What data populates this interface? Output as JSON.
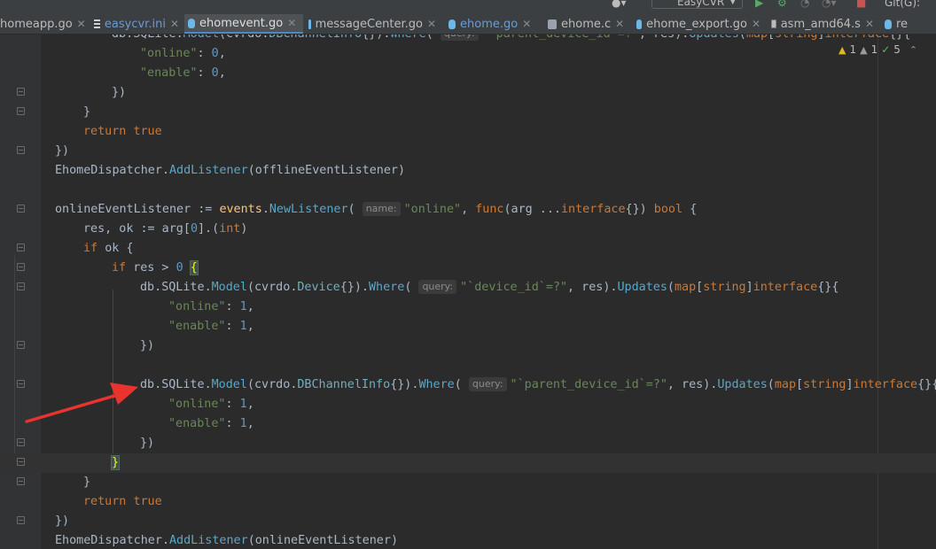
{
  "tabs": [
    {
      "label": "homeapp.go",
      "icon": "go-file-icon",
      "active": false
    },
    {
      "label": "easycvr.ini",
      "icon": "ini-file-icon",
      "active": false
    },
    {
      "label": "ehomevent.go",
      "icon": "go-file-icon",
      "active": true
    },
    {
      "label": "messageCenter.go",
      "icon": "go-file-icon",
      "active": false
    },
    {
      "label": "ehome.go",
      "icon": "go-file-icon",
      "active": false
    },
    {
      "label": "ehome.c",
      "icon": "c-file-icon",
      "active": false
    },
    {
      "label": "ehome_export.go",
      "icon": "go-file-icon",
      "active": false
    },
    {
      "label": "asm_amd64.s",
      "icon": "asm-file-icon",
      "active": false
    },
    {
      "label": "re",
      "icon": "go-file-icon",
      "active": false
    }
  ],
  "toolbar": {
    "run_config": "EasyCVR",
    "git_label": "Git(G):"
  },
  "inspections": {
    "warnings": "1",
    "weak_warnings": "1",
    "typos": "5"
  },
  "hints": {
    "query": "query:",
    "name": "name:"
  },
  "code": {
    "l0": "db.SQLite.Model(cvrdo.DBChannelInfo{}).Where(",
    "l0b": "\"`parent_device_id`=?\", res).Updates(map[string]interface{}{",
    "online": "\"online\"",
    "enable": "\"enable\"",
    "zero": "0",
    "one": "1",
    "close_paren": "})",
    "close_brace": "}",
    "close_all": "})",
    "return": "return",
    "true": "true",
    "dispatcher": "EhomeDispatcher",
    "add_listener": "AddListener",
    "offline_listener": "offlineEventListener",
    "online_listener": "onlineEventListener",
    "events": "events",
    "new_listener": "NewListener",
    "online_name": "\"online\"",
    "func": "func",
    "arg": "arg ...",
    "interface": "interface",
    "bool": "bool",
    "res_ok": "res, ok := arg[",
    "idx": "0",
    "int": "int",
    "if": "if",
    "ok": "ok",
    "res_gt": "res > ",
    "db": "db",
    "sqlite": "SQLite",
    "model": "Model",
    "cvrdo": "cvrdo",
    "device": "Device",
    "dbchannel": "DBChannelInfo",
    "where": "Where",
    "device_id_str": "\"`device_id`=?\"",
    "parent_id_str": "\"`parent_device_id`=?\"",
    "updates": "Updates",
    "map": "map",
    "string": "string"
  }
}
